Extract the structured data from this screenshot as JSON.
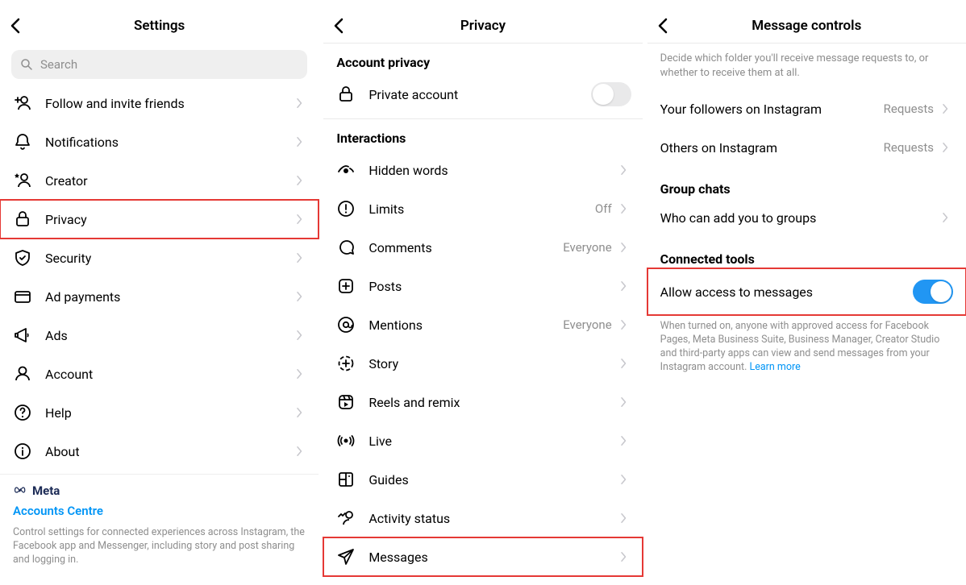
{
  "panel1": {
    "title": "Settings",
    "search_placeholder": "Search",
    "items": [
      {
        "label": "Follow and invite friends",
        "icon": "add-user"
      },
      {
        "label": "Notifications",
        "icon": "bell"
      },
      {
        "label": "Creator",
        "icon": "star-user"
      },
      {
        "label": "Privacy",
        "icon": "lock",
        "highlight": true
      },
      {
        "label": "Security",
        "icon": "shield"
      },
      {
        "label": "Ad payments",
        "icon": "card"
      },
      {
        "label": "Ads",
        "icon": "megaphone"
      },
      {
        "label": "Account",
        "icon": "user"
      },
      {
        "label": "Help",
        "icon": "help"
      },
      {
        "label": "About",
        "icon": "info"
      }
    ],
    "meta": {
      "brand": "Meta",
      "accounts_centre": "Accounts Centre",
      "description": "Control settings for connected experiences across Instagram, the Facebook app and Messenger, including story and post sharing and logging in."
    }
  },
  "panel2": {
    "title": "Privacy",
    "sections": {
      "account_privacy": "Account privacy",
      "interactions": "Interactions"
    },
    "private_account_label": "Private account",
    "private_account_on": false,
    "interactions": [
      {
        "label": "Hidden words",
        "icon": "eye-hidden",
        "value": ""
      },
      {
        "label": "Limits",
        "icon": "alert-circle",
        "value": "Off"
      },
      {
        "label": "Comments",
        "icon": "comment",
        "value": "Everyone"
      },
      {
        "label": "Posts",
        "icon": "plus-square",
        "value": ""
      },
      {
        "label": "Mentions",
        "icon": "at",
        "value": "Everyone"
      },
      {
        "label": "Story",
        "icon": "story-circle",
        "value": ""
      },
      {
        "label": "Reels and remix",
        "icon": "reels",
        "value": ""
      },
      {
        "label": "Live",
        "icon": "live",
        "value": ""
      },
      {
        "label": "Guides",
        "icon": "guides",
        "value": ""
      },
      {
        "label": "Activity status",
        "icon": "activity",
        "value": ""
      },
      {
        "label": "Messages",
        "icon": "send",
        "value": "",
        "highlight": true
      }
    ]
  },
  "panel3": {
    "title": "Message controls",
    "description": "Decide which folder you'll receive message requests to, or whether to receive them at all.",
    "rows": [
      {
        "label": "Your followers on Instagram",
        "value": "Requests"
      },
      {
        "label": "Others on Instagram",
        "value": "Requests"
      }
    ],
    "group_chats_header": "Group chats",
    "group_row_label": "Who can add you to groups",
    "connected_tools_header": "Connected tools",
    "allow_access_label": "Allow access to messages",
    "allow_access_on": true,
    "hint_text": "When turned on, anyone with approved access for Facebook Pages, Meta Business Suite, Business Manager, Creator Studio and third-party apps can view and send messages from your Instagram account. ",
    "learn_more": "Learn more"
  }
}
